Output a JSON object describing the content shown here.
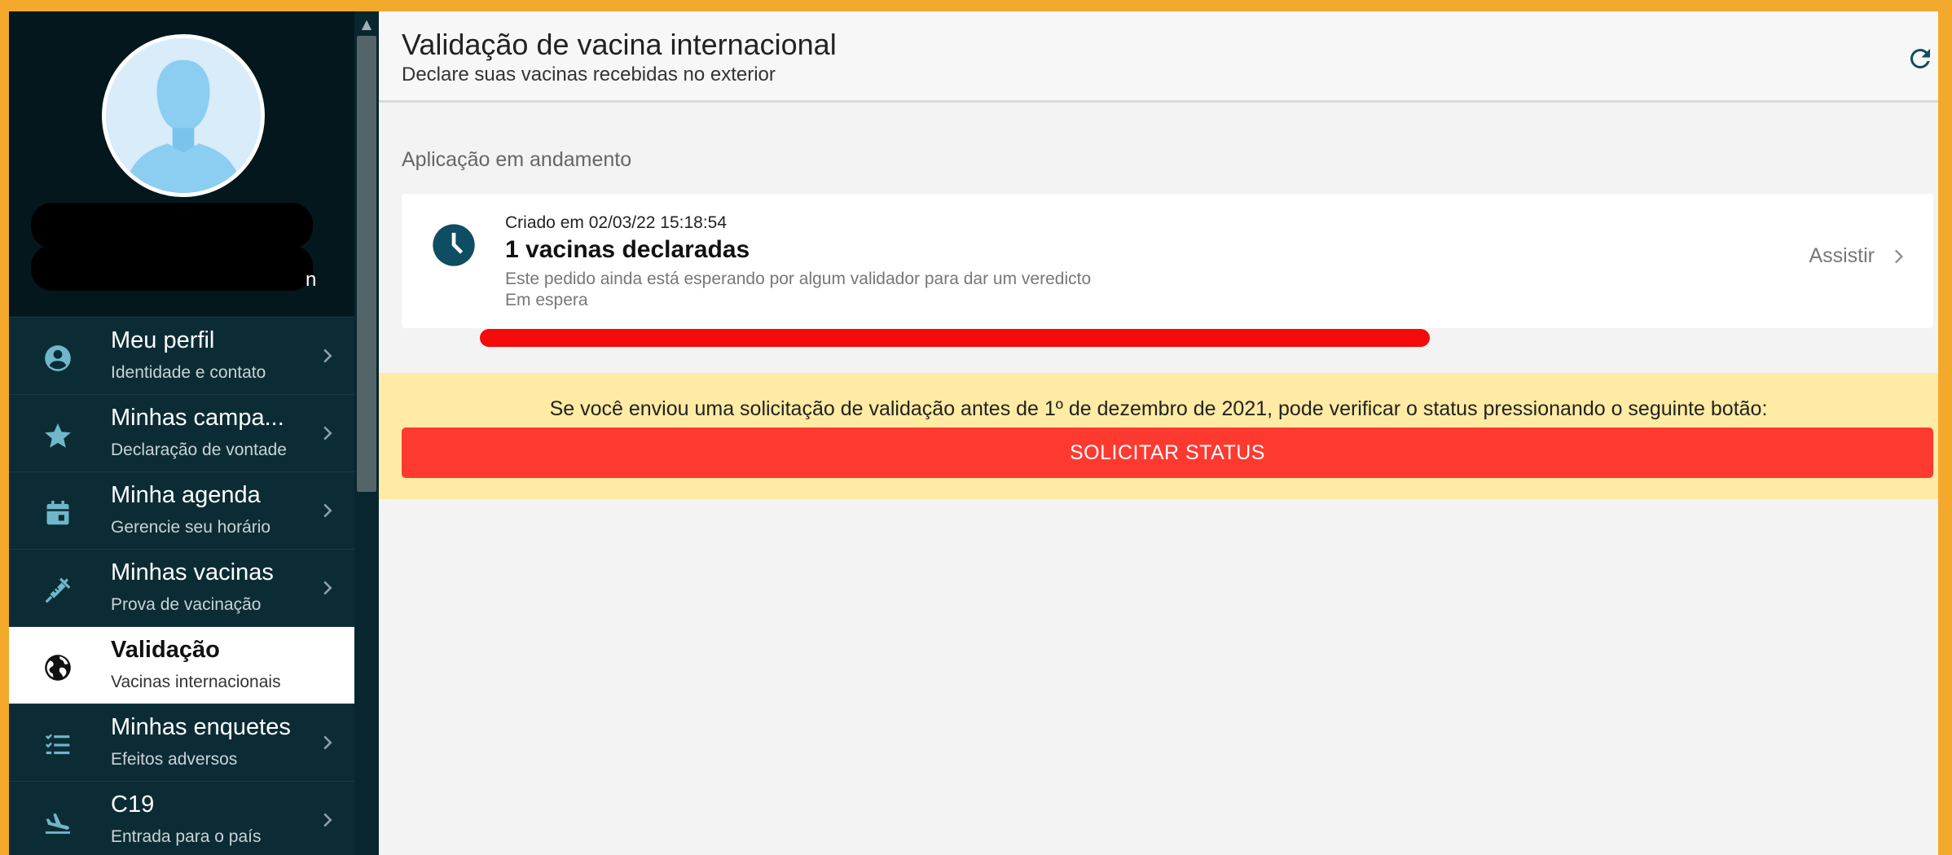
{
  "profile": {
    "name_visible_fragment": "n"
  },
  "nav": {
    "items": [
      {
        "title": "Meu perfil",
        "subtitle": "Identidade e contato",
        "icon": "account-circle-icon",
        "active": false
      },
      {
        "title": "Minhas campa...",
        "subtitle": "Declaração de vontade",
        "icon": "star-icon",
        "active": false
      },
      {
        "title": "Minha agenda",
        "subtitle": "Gerencie seu horário",
        "icon": "calendar-icon",
        "active": false
      },
      {
        "title": "Minhas vacinas",
        "subtitle": "Prova de vacinação",
        "icon": "syringe-icon",
        "active": false
      },
      {
        "title": "Validação",
        "subtitle": "Vacinas internacionais",
        "icon": "globe-icon",
        "active": true
      },
      {
        "title": "Minhas enquetes",
        "subtitle": "Efeitos adversos",
        "icon": "checklist-icon",
        "active": false
      },
      {
        "title": "C19",
        "subtitle": "Entrada para o país",
        "icon": "airplane-landing-icon",
        "active": false
      }
    ]
  },
  "header": {
    "title": "Validação de vacina internacional",
    "subtitle": "Declare suas vacinas recebidas no exterior",
    "refresh_icon": "refresh-icon"
  },
  "applications": {
    "section_label": "Aplicação em andamento",
    "card": {
      "created": "Criado em 02/03/22 15:18:54",
      "title": "1 vacinas declaradas",
      "description": "Este pedido ainda está esperando por algum validador para dar um veredicto",
      "status": "Em espera",
      "action_label": "Assistir",
      "icon": "clock-icon"
    }
  },
  "banner": {
    "text": "Se você enviou uma solicitação de validação antes de 1º de dezembro de 2021, pode verificar o status pressionando o seguinte botão:",
    "button_label": "SOLICITAR STATUS"
  },
  "colors": {
    "border": "#f2a92c",
    "sidebar": "#0c2c35",
    "accent_dark": "#0f4d63",
    "button_red": "#fe3a30",
    "banner_yellow": "#ffeba3"
  }
}
